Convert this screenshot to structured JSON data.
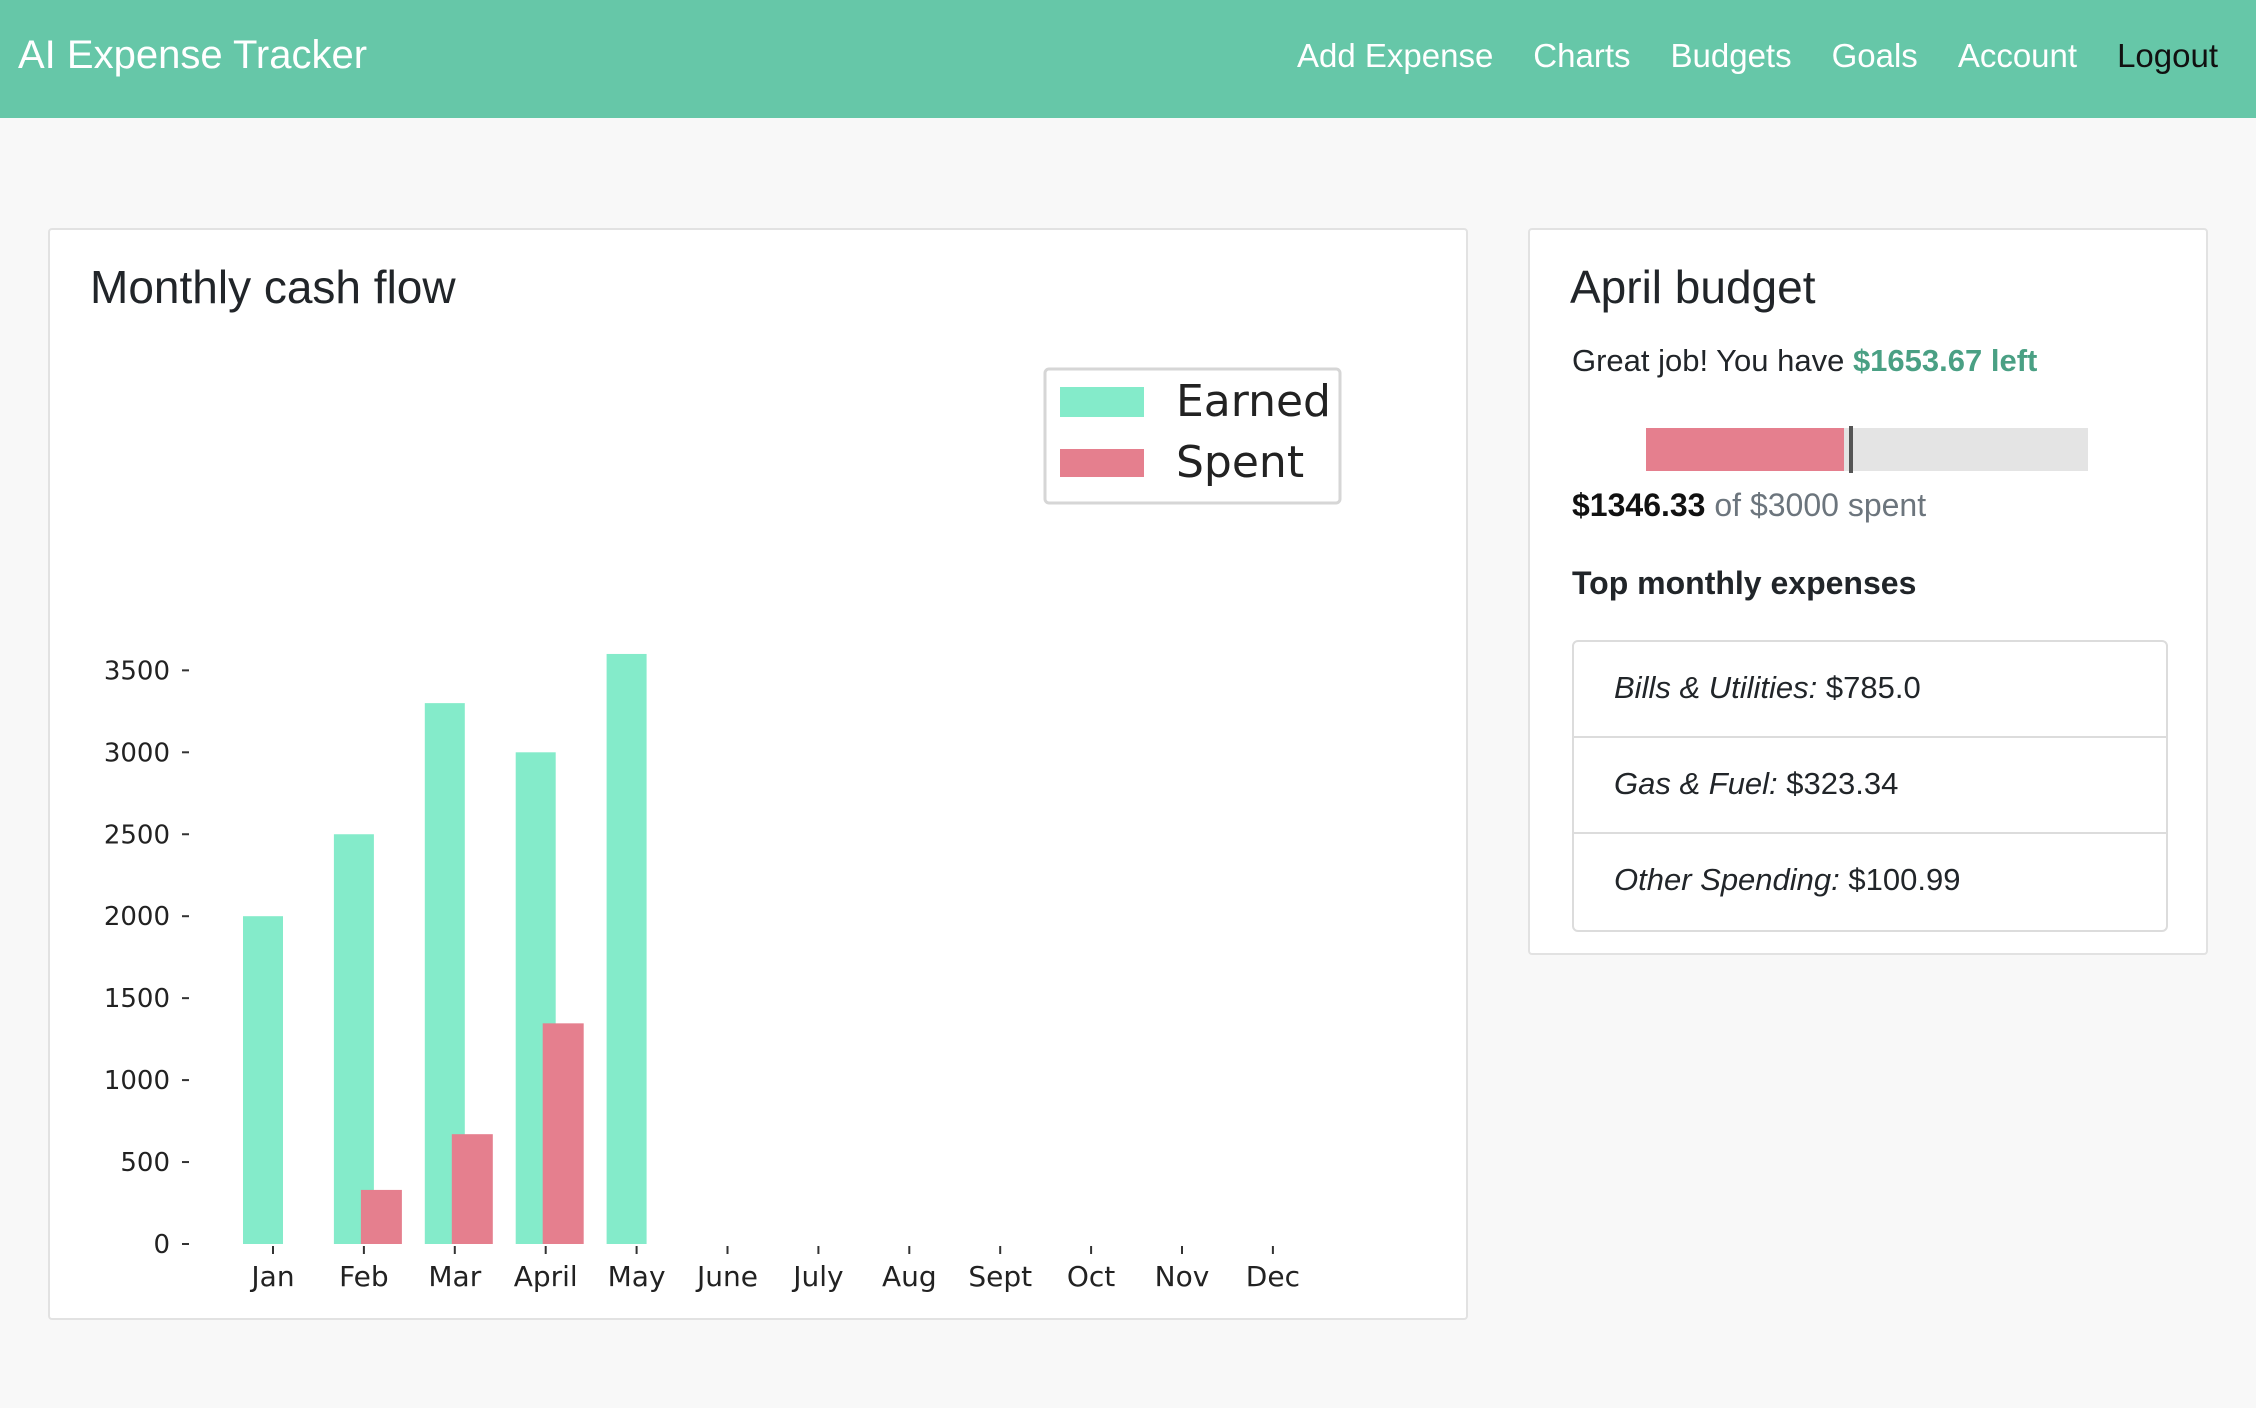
{
  "navbar": {
    "brand": "AI Expense Tracker",
    "links": [
      "Add Expense",
      "Charts",
      "Budgets",
      "Goals",
      "Account",
      "Logout"
    ],
    "background_color": "#66c7a8"
  },
  "chart_card": {
    "title": "Monthly cash flow"
  },
  "chart_data": {
    "type": "bar",
    "categories": [
      "Jan",
      "Feb",
      "Mar",
      "April",
      "May",
      "June",
      "July",
      "Aug",
      "Sept",
      "Oct",
      "Nov",
      "Dec"
    ],
    "series": [
      {
        "name": "Earned",
        "color": "#84ebca",
        "values": [
          2000,
          2500,
          3300,
          3000,
          3600,
          0,
          0,
          0,
          0,
          0,
          0,
          0
        ]
      },
      {
        "name": "Spent",
        "color": "#e57f8e",
        "values": [
          0,
          330,
          670,
          1346.33,
          0,
          0,
          0,
          0,
          0,
          0,
          0,
          0
        ]
      }
    ],
    "yticks": [
      0,
      500,
      1000,
      1500,
      2000,
      2500,
      3000,
      3500
    ],
    "ylim": [
      0,
      3600
    ],
    "grid": false,
    "legend": "top-right",
    "title": "",
    "xlabel": "",
    "ylabel": ""
  },
  "budget_card": {
    "title": "April budget",
    "message_prefix": "Great job! You have ",
    "left_amount": "$1653.67 left",
    "spent_amount": "$1346.33",
    "spent_suffix": " of $3000 spent",
    "spent_fraction": 0.4488,
    "marker_fraction": 0.46,
    "top_heading": "Top monthly expenses",
    "expenses": [
      {
        "category": "Bills & Utilities:",
        "amount": " $785.0"
      },
      {
        "category": "Gas & Fuel:",
        "amount": " $323.34"
      },
      {
        "category": "Other Spending:",
        "amount": " $100.99"
      }
    ]
  }
}
